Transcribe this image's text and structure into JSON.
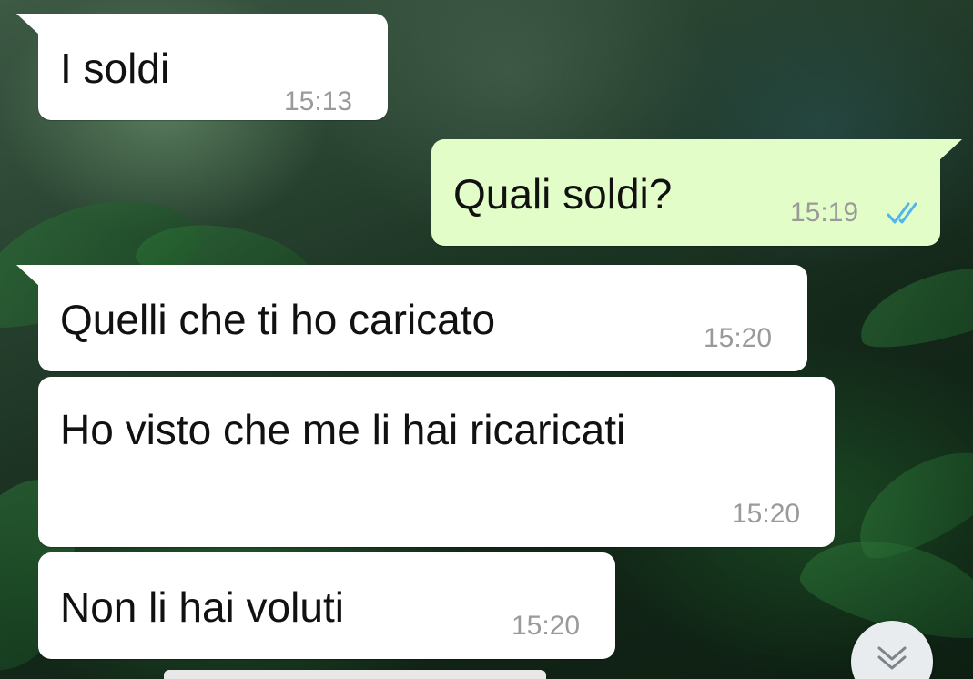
{
  "messages": [
    {
      "direction": "incoming",
      "text": "I soldi",
      "time": "15:13"
    },
    {
      "direction": "outgoing",
      "text": "Quali soldi?",
      "time": "15:19",
      "status": "read",
      "status_icon": "double-check-icon"
    },
    {
      "direction": "incoming",
      "text": "Quelli che ti ho caricato",
      "time": "15:20"
    },
    {
      "direction": "incoming",
      "text": "Ho visto che me li hai ricaricati",
      "time": "15:20"
    },
    {
      "direction": "incoming",
      "text": "Non li hai voluti",
      "time": "15:20"
    }
  ],
  "scroll_button": {
    "icon": "double-chevron-down-icon"
  },
  "colors": {
    "incoming_bubble": "#ffffff",
    "outgoing_bubble": "#e2fdc8",
    "timestamp": "#9a9a9a",
    "read_ticks": "#4fb6ec"
  }
}
